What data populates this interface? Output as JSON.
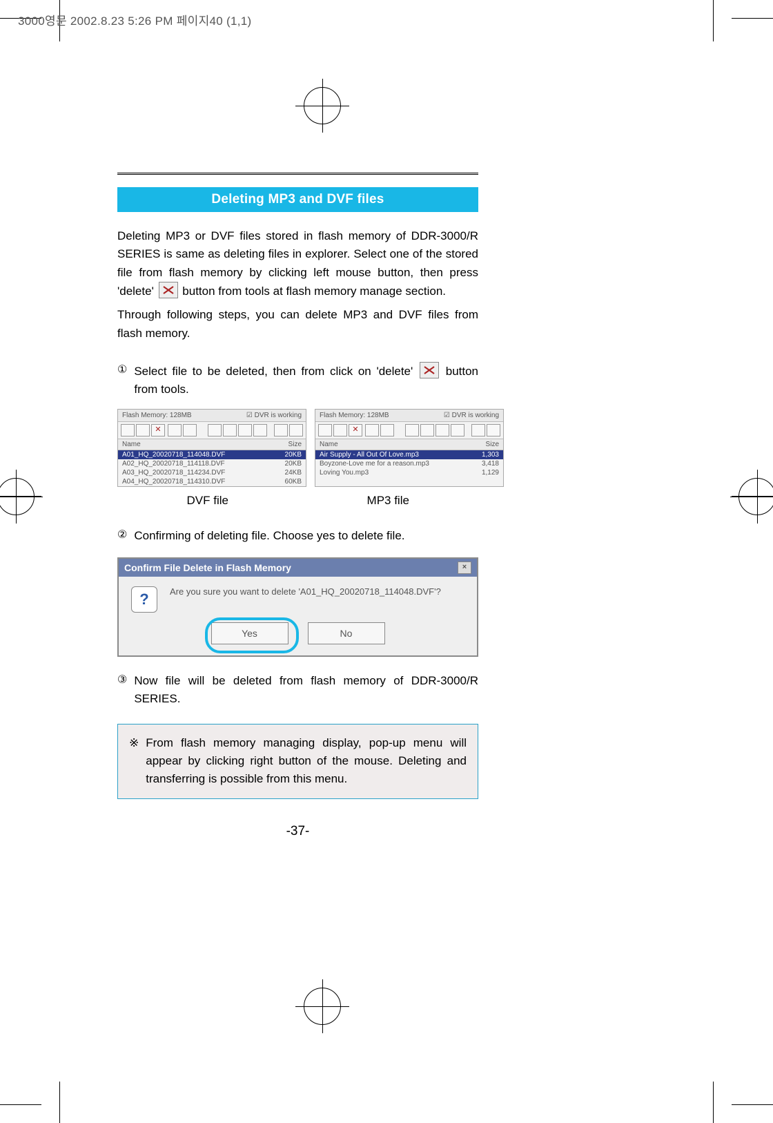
{
  "header": {
    "runhead": "3000영문  2002.8.23 5:26 PM  페이지40 (1,1)"
  },
  "title": "Deleting MP3 and DVF files",
  "intro": {
    "part1": "Deleting MP3 or DVF files stored in flash memory of DDR-3000/R SERIES is same as deleting files in explorer. Select one of the stored file from flash memory by clicking left mouse button, then press 'delete'",
    "part2": "button from tools at flash memory manage section.",
    "part3": "Through following steps, you can delete MP3 and DVF files from flash memory."
  },
  "steps": [
    {
      "marker": "①",
      "text_a": "Select file to be deleted, then from click on 'delete'",
      "text_b": "button from tools."
    },
    {
      "marker": "②",
      "text": "Confirming of deleting file. Choose yes to delete file."
    },
    {
      "marker": "③",
      "text": "Now file will be deleted from flash memory of DDR-3000/R SERIES."
    }
  ],
  "panels": {
    "columns": {
      "name": "Name",
      "size": "Size"
    },
    "dvf": {
      "title": "Flash Memory: 128MB",
      "status": "☑ DVR is working",
      "rows": [
        {
          "name": "A01_HQ_20020718_114048.DVF",
          "size": "20KB"
        },
        {
          "name": "A02_HQ_20020718_114118.DVF",
          "size": "20KB"
        },
        {
          "name": "A03_HQ_20020718_114234.DVF",
          "size": "24KB"
        },
        {
          "name": "A04_HQ_20020718_114310.DVF",
          "size": "60KB"
        }
      ]
    },
    "mp3": {
      "title": "Flash Memory: 128MB",
      "status": "☑ DVR is working",
      "rows": [
        {
          "name": "Air Supply - All Out Of Love.mp3",
          "size": "1,303"
        },
        {
          "name": "Boyzone-Love me for a reason.mp3",
          "size": "3,418"
        },
        {
          "name": "Loving You.mp3",
          "size": "1,129"
        }
      ]
    }
  },
  "captions": {
    "dvf": "DVF file",
    "mp3": "MP3 file"
  },
  "dialog": {
    "title": "Confirm File Delete in Flash Memory",
    "message": "Are you sure you want to delete 'A01_HQ_20020718_114048.DVF'?",
    "yes": "Yes",
    "no": "No"
  },
  "note": {
    "marker": "※",
    "text": "From flash memory managing display, pop-up menu will appear by clicking right button of the mouse. Deleting and transferring is possible from this menu."
  },
  "page_number": "-37-"
}
